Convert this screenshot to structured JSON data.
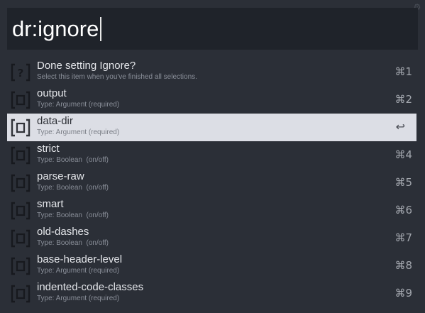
{
  "query": {
    "text": "dr:ignore"
  },
  "results": [
    {
      "title": "Done setting Ignore?",
      "subtitle": "Select this item when you've finished all selections.",
      "shortcut": "⌘1",
      "icon": "question-bracket-icon",
      "selected": false
    },
    {
      "title": "output",
      "subtitle": "Type: Argument (required)",
      "shortcut": "⌘2",
      "icon": "bracket-box-icon",
      "selected": false
    },
    {
      "title": "data-dir",
      "subtitle": "Type: Argument (required)",
      "shortcut": "↩",
      "icon": "bracket-box-icon",
      "selected": true
    },
    {
      "title": "strict",
      "subtitle": "Type: Boolean  (on/off)",
      "shortcut": "⌘4",
      "icon": "bracket-box-icon",
      "selected": false
    },
    {
      "title": "parse-raw",
      "subtitle": "Type: Boolean  (on/off)",
      "shortcut": "⌘5",
      "icon": "bracket-box-icon",
      "selected": false
    },
    {
      "title": "smart",
      "subtitle": "Type: Boolean  (on/off)",
      "shortcut": "⌘6",
      "icon": "bracket-box-icon",
      "selected": false
    },
    {
      "title": "old-dashes",
      "subtitle": "Type: Boolean  (on/off)",
      "shortcut": "⌘7",
      "icon": "bracket-box-icon",
      "selected": false
    },
    {
      "title": "base-header-level",
      "subtitle": "Type: Argument (required)",
      "shortcut": "⌘8",
      "icon": "bracket-box-icon",
      "selected": false
    },
    {
      "title": "indented-code-classes",
      "subtitle": "Type: Argument (required)",
      "shortcut": "⌘9",
      "icon": "bracket-box-icon",
      "selected": false
    }
  ],
  "colors": {
    "background": "#2b2f37",
    "query_background": "#1f232a",
    "selected_row": "#dcdee5",
    "icon_dark": "#17191e",
    "icon_selected": "#2f3238"
  }
}
